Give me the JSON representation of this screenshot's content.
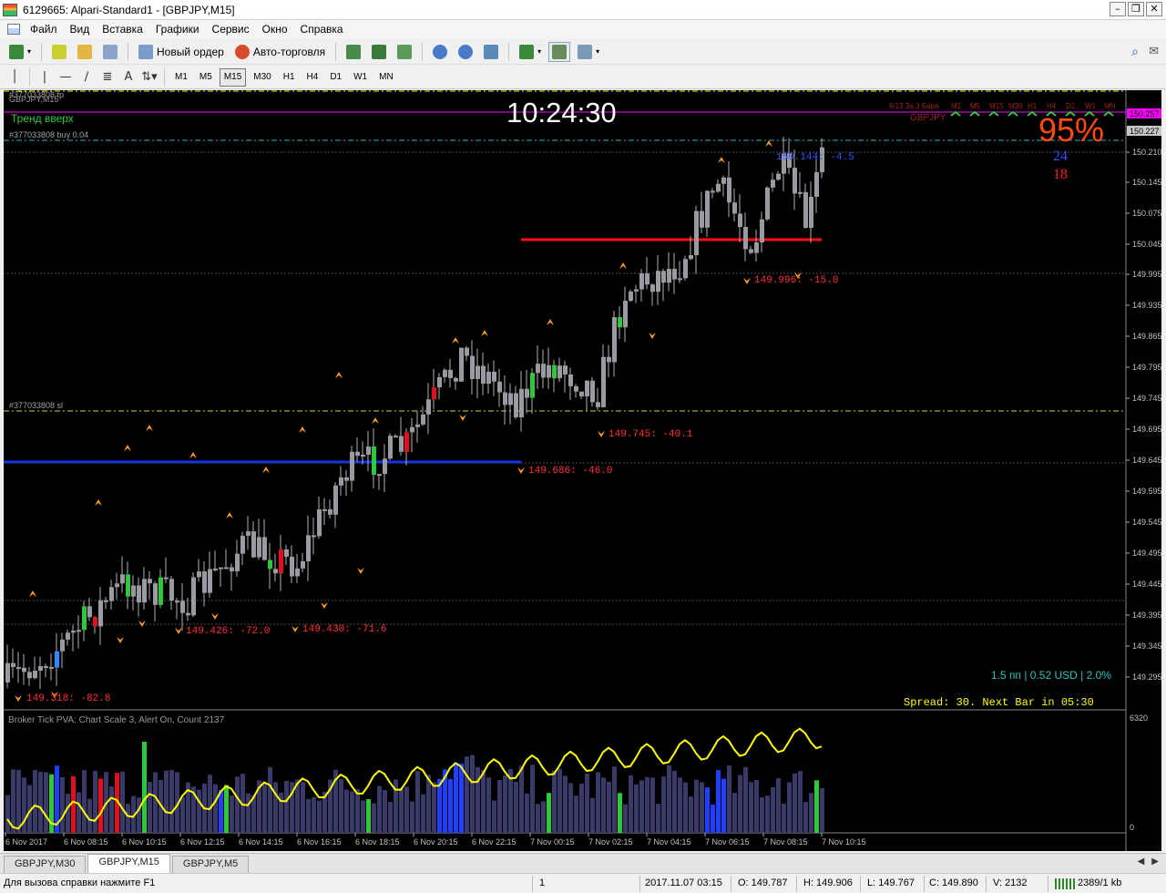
{
  "window": {
    "title": "6129665: Alpari-Standard1 - [GBPJPY,M15]"
  },
  "menu": [
    "Файл",
    "Вид",
    "Вставка",
    "Графики",
    "Сервис",
    "Окно",
    "Справка"
  ],
  "toolbar": {
    "new_order": "Новый ордер",
    "auto_trading": "Авто-торговля"
  },
  "timeframes": [
    "M1",
    "M5",
    "M15",
    "M30",
    "H1",
    "H4",
    "D1",
    "W1",
    "MN"
  ],
  "active_timeframe": "M15",
  "chart": {
    "symbol_label": "GBPJPY,M15",
    "trend": "Тренд вверх",
    "order_line": "#377033808 buy 0.04",
    "order_top": "#377033808 tp",
    "order_sl": "#377033808 sl",
    "clock": "10:24:30",
    "percent": "95%",
    "num_blue": "24",
    "num_red": "18",
    "mtf_header": "6/13 За 3 Бара",
    "mtf_symbol": "GBPJPY",
    "mtf_tfs": [
      "M1",
      "M5",
      "M15",
      "M30",
      "H1",
      "H4",
      "D1",
      "W1",
      "MN"
    ],
    "pip_info": "1.5 пп | 0.52 USD | 2.0%",
    "spread": "Spread: 30. Next Bar in 05:30",
    "price_labels": [
      "150.257",
      "150.227"
    ],
    "y_ticks": [
      "150.210",
      "150.145",
      "150.075",
      "150.045",
      "149.995",
      "149.935",
      "149.865",
      "149.795",
      "149.745",
      "149.695",
      "149.645",
      "149.595",
      "149.545",
      "149.495",
      "149.445",
      "149.395",
      "149.345",
      "149.295"
    ],
    "annotations": [
      {
        "text": "149.318: -82.8",
        "color": "#ff3030"
      },
      {
        "text": "149.426: -72.0",
        "color": "#ff3030"
      },
      {
        "text": "149.430: -71.6",
        "color": "#ff3030"
      },
      {
        "text": "149.686: -46.0",
        "color": "#ff3030"
      },
      {
        "text": "149.745: -40.1",
        "color": "#ff3030"
      },
      {
        "text": "149.996: -15.0",
        "color": "#ff3030"
      },
      {
        "text": "150.144: -4.5",
        "color": "#3050ff"
      }
    ],
    "indicator_label": "Broker Tick PVA:    Chart Scale 3,  Alert On,  Count  2137",
    "indicator_scale": [
      "6320",
      "0"
    ],
    "x_ticks": [
      "6 Nov 2017",
      "6 Nov 08:15",
      "6 Nov 10:15",
      "6 Nov 12:15",
      "6 Nov 14:15",
      "6 Nov 16:15",
      "6 Nov 18:15",
      "6 Nov 20:15",
      "6 Nov 22:15",
      "7 Nov 00:15",
      "7 Nov 02:15",
      "7 Nov 04:15",
      "7 Nov 06:15",
      "7 Nov 08:15",
      "7 Nov 10:15"
    ]
  },
  "tabs": [
    "GBPJPY,M30",
    "GBPJPY,M15",
    "GBPJPY,M5"
  ],
  "active_tab": "GBPJPY,M15",
  "status": {
    "help": "Для вызова справки нажмите F1",
    "profile": "1",
    "datetime": "2017.11.07 03:15",
    "open": "O: 149.787",
    "high": "H: 149.906",
    "low": "L: 149.767",
    "close": "C: 149.890",
    "volume": "V: 2132",
    "traffic": "2389/1 kb"
  },
  "colors": {
    "bull": "#2ec83c",
    "bear": "#e01020",
    "neutral": "#9a9aa2",
    "blue_line": "#1030ff",
    "red_line": "#ff1010",
    "magenta": "#ff00ff",
    "yellow": "#ffff00"
  }
}
